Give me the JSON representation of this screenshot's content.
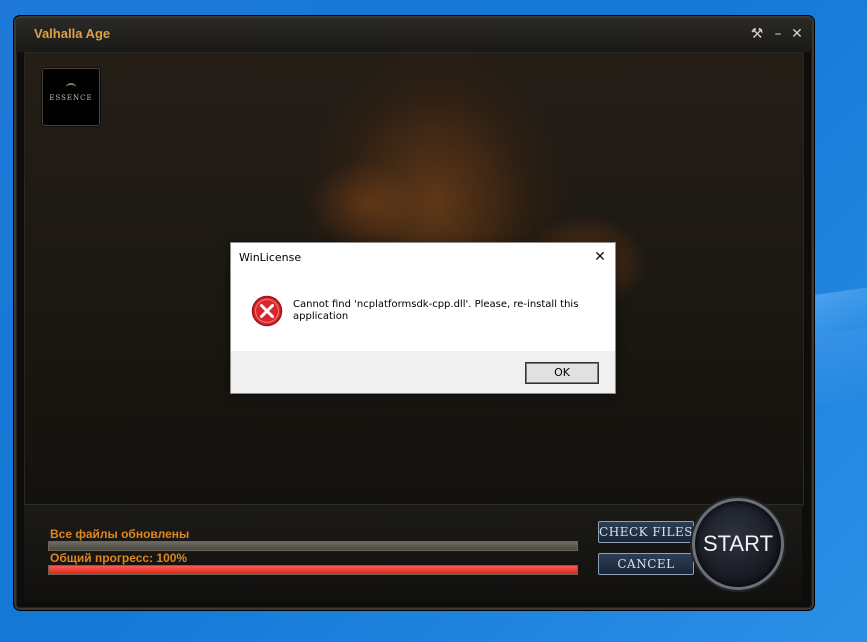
{
  "launcher": {
    "title": "Valhalla Age",
    "logo_text": "ESSENCE",
    "status_text": "Все файлы обновлены",
    "files_progress": 1.0,
    "total_progress_label": "Общий прогресс: 100%",
    "total_progress": 1.0,
    "check_files_label": "CHECK FILES",
    "cancel_label": "CANCEL",
    "start_label": "START",
    "accent_color": "#e0861f"
  },
  "icons": {
    "settings": "tools-icon",
    "minimize": "minimize-icon",
    "close": "close-icon",
    "error": "error-icon"
  },
  "dialog": {
    "title": "WinLicense",
    "message": "Cannot find 'ncplatformsdk-cpp.dll'. Please, re-install this application",
    "ok_label": "OK"
  }
}
